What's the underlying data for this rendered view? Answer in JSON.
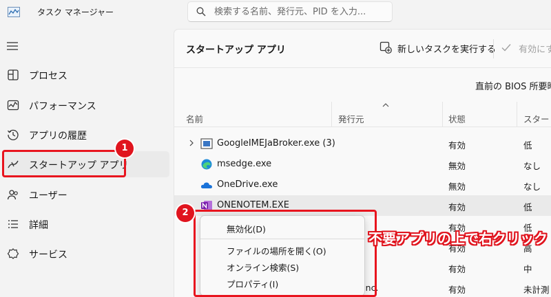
{
  "titlebar": {
    "app_title": "タスク マネージャー",
    "search_placeholder": "検索する名前、発行元、PID を入力..."
  },
  "sidebar": {
    "items": [
      {
        "label": "プロセス",
        "icon": "processes-icon"
      },
      {
        "label": "パフォーマンス",
        "icon": "performance-icon"
      },
      {
        "label": "アプリの履歴",
        "icon": "app-history-icon"
      },
      {
        "label": "スタートアップ アプリ",
        "icon": "startup-apps-icon",
        "selected": true
      },
      {
        "label": "ユーザー",
        "icon": "users-icon"
      },
      {
        "label": "詳細",
        "icon": "details-icon"
      },
      {
        "label": "サービス",
        "icon": "services-icon"
      }
    ]
  },
  "main": {
    "title": "スタートアップ アプリ",
    "run_task_label": "新しいタスクを実行する",
    "enable_label": "有効にす",
    "bios_label": "直前の BIOS 所要時",
    "columns": [
      "名前",
      "発行元",
      "状態",
      "スタートア"
    ],
    "rows": [
      {
        "name": "GoogleIMEJaBroker.exe (3)",
        "publisher": "",
        "status": "有効",
        "impact": "低",
        "expandable": true
      },
      {
        "name": "msedge.exe",
        "publisher": "",
        "status": "無効",
        "impact": "なし"
      },
      {
        "name": "OneDrive.exe",
        "publisher": "",
        "status": "無効",
        "impact": "なし"
      },
      {
        "name": "ONENOTEM.EXE",
        "publisher": "",
        "status": "有効",
        "impact": "低",
        "highlight": true
      },
      {
        "name": "",
        "publisher": "",
        "status": "有効",
        "impact": "低"
      },
      {
        "name": "",
        "publisher": "",
        "status": "有効",
        "impact": "高"
      },
      {
        "name": "",
        "publisher": "",
        "status": "有効",
        "impact": "中"
      },
      {
        "name": "",
        "publisher": "Inc.",
        "status": "有効",
        "impact": "未計測"
      }
    ]
  },
  "context_menu": {
    "items": [
      "無効化(D)",
      "ファイルの場所を開く(O)",
      "オンライン検索(S)",
      "プロパティ(I)"
    ]
  },
  "annotations": {
    "badge1": "1",
    "badge2": "2",
    "callout": "不要アプリの上で右クリック"
  },
  "colors": {
    "accent_red": "#e0141e",
    "selected_bg": "#eaeaea"
  }
}
